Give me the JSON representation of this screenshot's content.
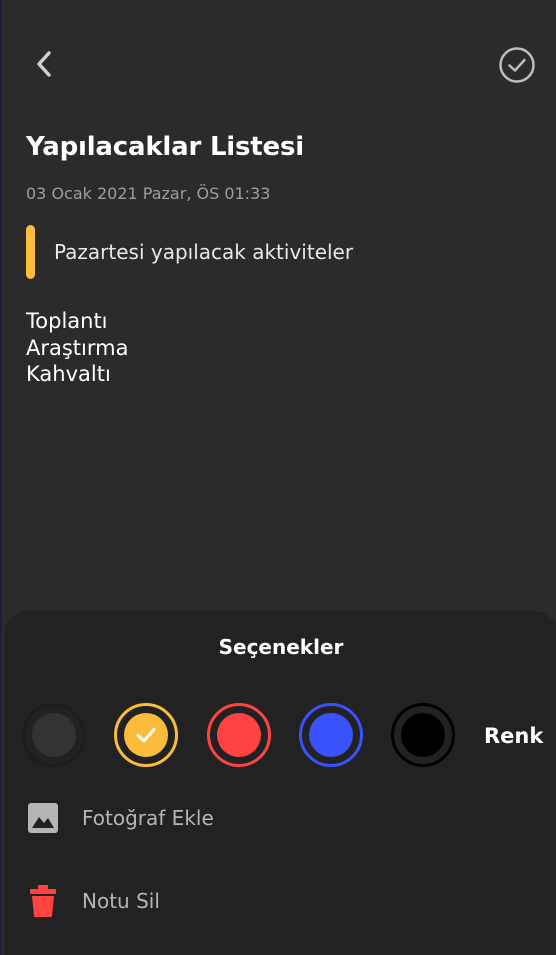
{
  "header": {
    "back_icon": "chevron-left-icon",
    "save_icon": "check-circle-icon"
  },
  "note": {
    "title": "Yapılacaklar Listesi",
    "datetime": "03 Ocak 2021 Pazar, ÖS 01:33",
    "subtitle": "Pazartesi yapılacak aktiviteler",
    "accent_color": "#fbbc3b",
    "lines": [
      "Toplantı",
      "Araştırma",
      "Kahvaltı"
    ]
  },
  "options_sheet": {
    "title": "Seçenekler",
    "color_label": "Renk",
    "colors": [
      {
        "name": "default",
        "hex": "#333333",
        "ring": "#1e1e1e",
        "selected": false
      },
      {
        "name": "yellow",
        "hex": "#fbbc3b",
        "ring": "#fbbc3b",
        "selected": true
      },
      {
        "name": "red",
        "hex": "#ff4242",
        "ring": "#ff4242",
        "selected": false
      },
      {
        "name": "blue",
        "hex": "#3a52fc",
        "ring": "#3a52fc",
        "selected": false
      },
      {
        "name": "black",
        "hex": "#000000",
        "ring": "#000000",
        "selected": false
      }
    ],
    "add_photo": {
      "label": "Fotoğraf Ekle",
      "icon": "image-icon"
    },
    "delete_note": {
      "label": "Notu Sil",
      "icon": "trash-icon",
      "icon_color": "#ff4242"
    }
  }
}
